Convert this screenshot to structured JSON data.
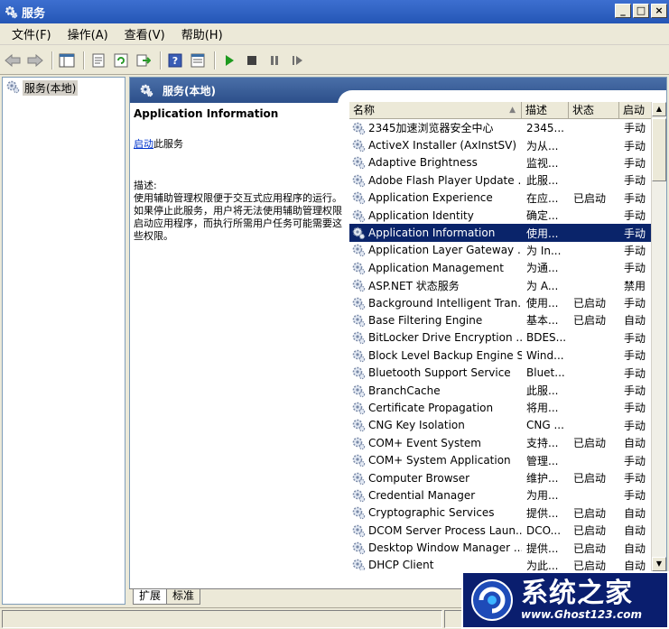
{
  "window": {
    "title": "服务",
    "controls": [
      "_",
      "□",
      "×"
    ]
  },
  "menu": [
    "文件(F)",
    "操作(A)",
    "查看(V)",
    "帮助(H)"
  ],
  "toolbar": {
    "buttons": [
      "back-icon",
      "forward-icon",
      "console-tree-icon",
      "properties-icon",
      "refresh-icon",
      "export-icon",
      "help-icon",
      "view-icon",
      "start-icon",
      "stop-icon",
      "pause-icon",
      "restart-icon"
    ]
  },
  "tree": {
    "root_label": "服务(本地)"
  },
  "pane_header": {
    "title": "服务(本地)"
  },
  "details": {
    "service_name": "Application Information",
    "start_link": "启动",
    "start_suffix": "此服务",
    "desc_label": "描述:",
    "desc_text": "使用辅助管理权限便于交互式应用程序的运行。如果停止此服务，用户将无法使用辅助管理权限启动应用程序，而执行所需用户任务可能需要这些权限。"
  },
  "list": {
    "columns": {
      "name": "名称",
      "desc": "描述",
      "status": "状态",
      "start": "启动"
    },
    "selected_index": 6,
    "rows": [
      {
        "name": "2345加速浏览器安全中心",
        "desc": "2345...",
        "status": "",
        "start": "手动"
      },
      {
        "name": "ActiveX Installer (AxInstSV)",
        "desc": "为从...",
        "status": "",
        "start": "手动"
      },
      {
        "name": "Adaptive Brightness",
        "desc": "监视...",
        "status": "",
        "start": "手动"
      },
      {
        "name": "Adobe Flash Player Update ...",
        "desc": "此服...",
        "status": "",
        "start": "手动"
      },
      {
        "name": "Application Experience",
        "desc": "在应...",
        "status": "已启动",
        "start": "手动"
      },
      {
        "name": "Application Identity",
        "desc": "确定...",
        "status": "",
        "start": "手动"
      },
      {
        "name": "Application Information",
        "desc": "使用...",
        "status": "",
        "start": "手动"
      },
      {
        "name": "Application Layer Gateway ...",
        "desc": "为 In...",
        "status": "",
        "start": "手动"
      },
      {
        "name": "Application Management",
        "desc": "为通...",
        "status": "",
        "start": "手动"
      },
      {
        "name": "ASP.NET 状态服务",
        "desc": "为 A...",
        "status": "",
        "start": "禁用"
      },
      {
        "name": "Background Intelligent Tran...",
        "desc": "使用...",
        "status": "已启动",
        "start": "手动"
      },
      {
        "name": "Base Filtering Engine",
        "desc": "基本...",
        "status": "已启动",
        "start": "自动"
      },
      {
        "name": "BitLocker Drive Encryption ...",
        "desc": "BDES...",
        "status": "",
        "start": "手动"
      },
      {
        "name": "Block Level Backup Engine S...",
        "desc": "Wind...",
        "status": "",
        "start": "手动"
      },
      {
        "name": "Bluetooth Support Service",
        "desc": "Bluet...",
        "status": "",
        "start": "手动"
      },
      {
        "name": "BranchCache",
        "desc": "此服...",
        "status": "",
        "start": "手动"
      },
      {
        "name": "Certificate Propagation",
        "desc": "将用...",
        "status": "",
        "start": "手动"
      },
      {
        "name": "CNG Key Isolation",
        "desc": "CNG ...",
        "status": "",
        "start": "手动"
      },
      {
        "name": "COM+ Event System",
        "desc": "支持...",
        "status": "已启动",
        "start": "自动"
      },
      {
        "name": "COM+ System Application",
        "desc": "管理...",
        "status": "",
        "start": "手动"
      },
      {
        "name": "Computer Browser",
        "desc": "维护...",
        "status": "已启动",
        "start": "手动"
      },
      {
        "name": "Credential Manager",
        "desc": "为用...",
        "status": "",
        "start": "手动"
      },
      {
        "name": "Cryptographic Services",
        "desc": "提供...",
        "status": "已启动",
        "start": "自动"
      },
      {
        "name": "DCOM Server Process Laun...",
        "desc": "DCO...",
        "status": "已启动",
        "start": "自动"
      },
      {
        "name": "Desktop Window Manager ...",
        "desc": "提供...",
        "status": "已启动",
        "start": "自动"
      },
      {
        "name": "DHCP Client",
        "desc": "为此...",
        "status": "已启动",
        "start": "自动"
      }
    ]
  },
  "tabs": [
    "扩展",
    "标准"
  ],
  "watermark": {
    "cn": "系统之家",
    "url": "www.Ghost123.com"
  }
}
